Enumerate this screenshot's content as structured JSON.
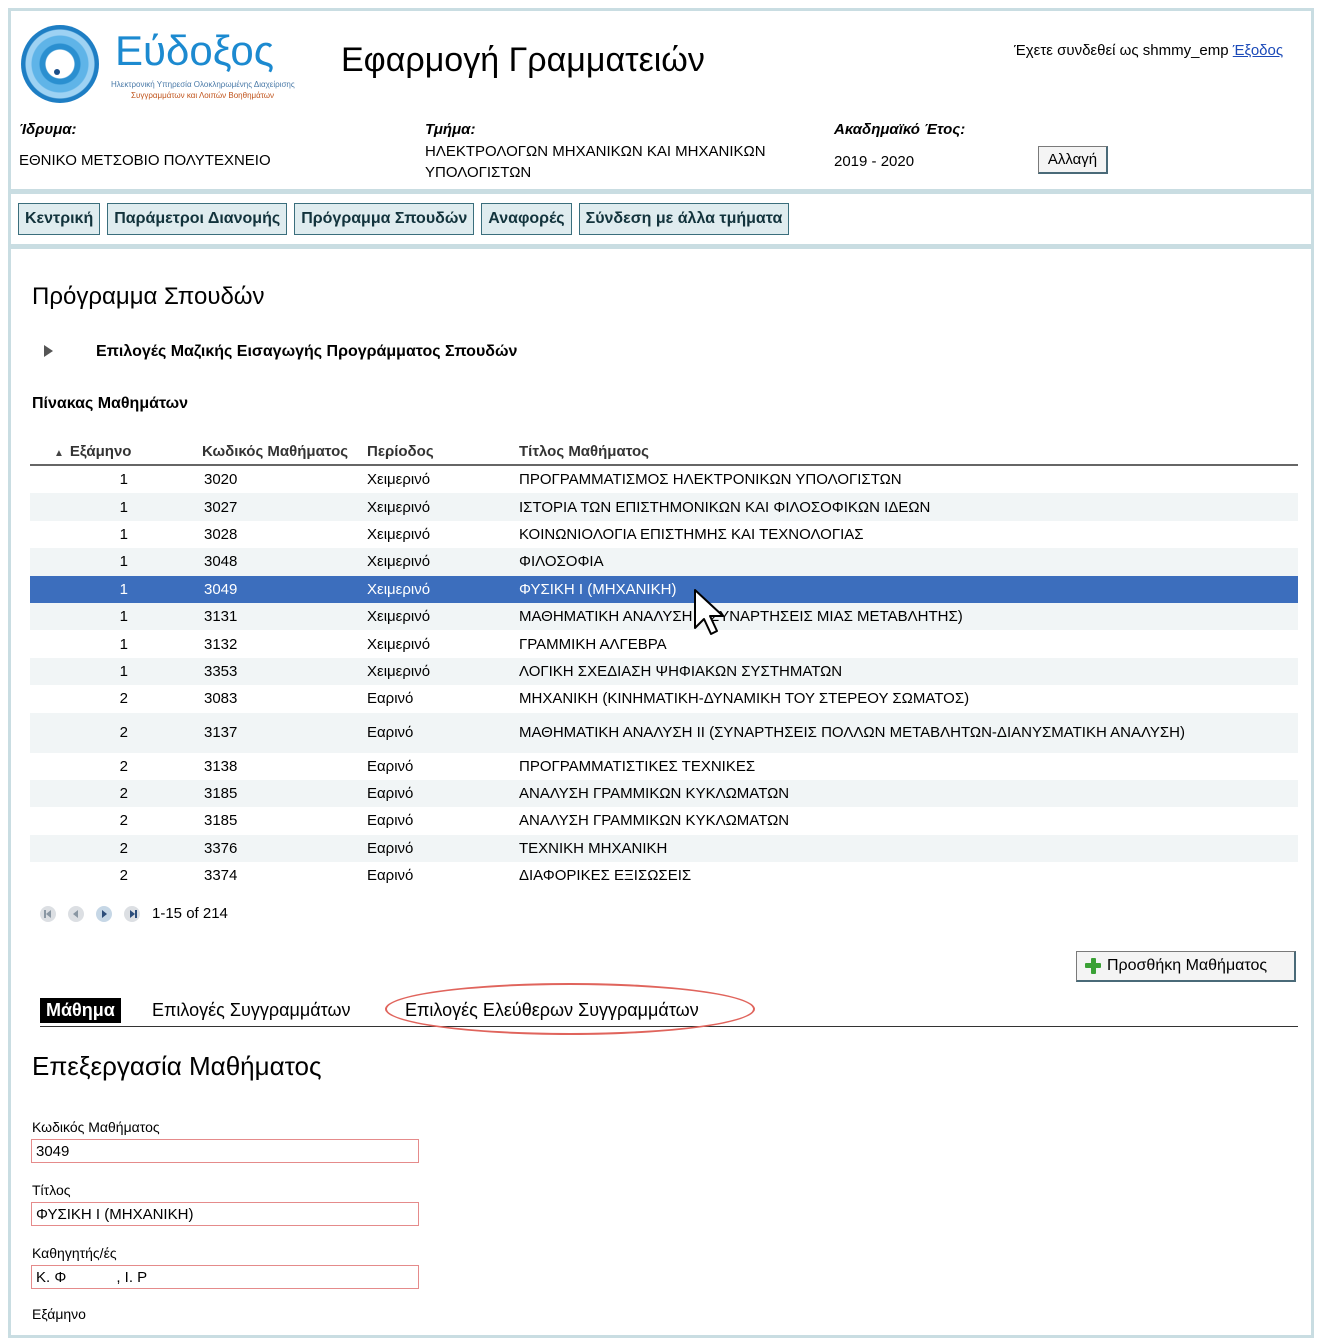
{
  "header": {
    "brand": "Εύδοξος",
    "brand_sub1": "Ηλεκτρονική Υπηρεσία Ολοκληρωμένης Διαχείρισης",
    "brand_sub2": "Συγγραμμάτων και Λοιπών Βοηθημάτων",
    "app_title": "Εφαρμογή Γραμματειών",
    "login_text": "Έχετε συνδεθεί ως shmmy_emp",
    "logout_label": "Έξοδος"
  },
  "info": {
    "institution_label": "Ίδρυμα:",
    "institution": "ΕΘΝΙΚΟ ΜΕΤΣΟΒΙΟ ΠΟΛΥΤΕΧΝΕΙΟ",
    "department_label": "Τμήμα:",
    "department_line1": "ΗΛΕΚΤΡΟΛΟΓΩΝ ΜΗΧΑΝΙΚΩΝ ΚΑΙ ΜΗΧΑΝΙΚΩΝ",
    "department_line2": "ΥΠΟΛΟΓΙΣΤΩΝ",
    "year_label": "Ακαδημαϊκό Έτος:",
    "year": "2019 - 2020",
    "change_label": "Αλλαγή"
  },
  "nav": [
    "Κεντρική",
    "Παράμετροι Διανομής",
    "Πρόγραμμα Σπουδών",
    "Αναφορές",
    "Σύνδεση με άλλα τμήματα"
  ],
  "main": {
    "page_title": "Πρόγραμμα Σπουδών",
    "bulk_title": "Επιλογές Μαζικής Εισαγωγής Προγράμματος Σπουδών",
    "table_title": "Πίνακας Μαθημάτων"
  },
  "table": {
    "headers": [
      "Εξάμηνο",
      "Κωδικός Μαθήματος",
      "Περίοδος",
      "Τίτλος Μαθήματος"
    ],
    "rows": [
      [
        "1",
        "3020",
        "Χειμερινό",
        "ΠΡΟΓΡΑΜΜΑΤΙΣΜΟΣ ΗΛΕΚΤΡΟΝΙΚΩΝ ΥΠΟΛΟΓΙΣΤΩΝ"
      ],
      [
        "1",
        "3027",
        "Χειμερινό",
        "ΙΣΤΟΡΙΑ ΤΩΝ ΕΠΙΣΤΗΜΟΝΙΚΩΝ ΚΑΙ ΦΙΛΟΣΟΦΙΚΩΝ ΙΔΕΩΝ"
      ],
      [
        "1",
        "3028",
        "Χειμερινό",
        "ΚΟΙΝΩΝΙΟΛΟΓΙΑ ΕΠΙΣΤΗΜΗΣ ΚΑΙ ΤΕΧΝΟΛΟΓΙΑΣ"
      ],
      [
        "1",
        "3048",
        "Χειμερινό",
        "ΦΙΛΟΣΟΦΙΑ"
      ],
      [
        "1",
        "3049",
        "Χειμερινό",
        "ΦΥΣΙΚΗ Ι (ΜΗΧΑΝΙΚΗ)"
      ],
      [
        "1",
        "3131",
        "Χειμερινό",
        "ΜΑΘΗΜΑΤΙΚΗ ΑΝΑΛΥΣΗ Ι (ΣΥΝΑΡΤΗΣΕΙΣ ΜΙΑΣ ΜΕΤΑΒΛΗΤΗΣ)"
      ],
      [
        "1",
        "3132",
        "Χειμερινό",
        "ΓΡΑΜΜΙΚΗ ΑΛΓΕΒΡΑ"
      ],
      [
        "1",
        "3353",
        "Χειμερινό",
        "ΛΟΓΙΚΗ ΣΧΕΔΙΑΣΗ ΨΗΦΙΑΚΩΝ ΣΥΣΤΗΜΑΤΩΝ"
      ],
      [
        "2",
        "3083",
        "Εαρινό",
        "ΜΗΧΑΝΙΚΗ (ΚΙΝΗΜΑΤΙΚΗ-ΔΥΝΑΜΙΚΗ ΤΟΥ ΣΤΕΡΕΟΥ ΣΩΜΑΤΟΣ)"
      ],
      [
        "2",
        "3137",
        "Εαρινό",
        "ΜΑΘΗΜΑΤΙΚΗ ΑΝΑΛΥΣΗ ΙΙ (ΣΥΝΑΡΤΗΣΕΙΣ ΠΟΛΛΩΝ ΜΕΤΑΒΛΗΤΩΝ-ΔΙΑΝΥΣΜΑΤΙΚΗ ΑΝΑΛΥΣΗ)"
      ],
      [
        "2",
        "3138",
        "Εαρινό",
        "ΠΡΟΓΡΑΜΜΑΤΙΣΤΙΚΕΣ ΤΕΧΝΙΚΕΣ"
      ],
      [
        "2",
        "3185",
        "Εαρινό",
        "ΑΝΑΛΥΣΗ ΓΡΑΜΜΙΚΩΝ ΚΥΚΛΩΜΑΤΩΝ"
      ],
      [
        "2",
        "3185",
        "Εαρινό",
        "ΑΝΑΛΥΣΗ ΓΡΑΜΜΙΚΩΝ ΚΥΚΛΩΜΑΤΩΝ"
      ],
      [
        "2",
        "3376",
        "Εαρινό",
        "ΤΕΧΝΙΚΗ ΜΗΧΑΝΙΚΗ"
      ],
      [
        "2",
        "3374",
        "Εαρινό",
        "ΔΙΑΦΟΡΙΚΕΣ ΕΞΙΣΩΣΕΙΣ"
      ]
    ],
    "selected_row": 4
  },
  "pager": {
    "text": "1-15 of 214"
  },
  "add_course_label": "Προσθήκη Μαθήματος",
  "tabs": [
    "Μάθημα",
    "Επιλογές Συγγραμμάτων",
    "Επιλογές Ελεύθερων Συγγραμμάτων"
  ],
  "edit": {
    "title": "Επεξεργασία Μαθήματος",
    "code_label": "Κωδικός Μαθήματος",
    "code_value": "3049",
    "name_label": "Τίτλος",
    "name_value": "ΦΥΣΙΚΗ Ι (ΜΗΧΑΝΙΚΗ)",
    "prof_label": "Καθηγητής/ές",
    "prof_value": "Κ. Φ            , Ι. Ρ",
    "semester_label": "Εξάμηνο"
  },
  "colors": {
    "frame": "#c9dde2",
    "selected_row": "#3c6ebd",
    "nav_bg": "#dfecef",
    "highlight_oval": "#e0645c"
  }
}
